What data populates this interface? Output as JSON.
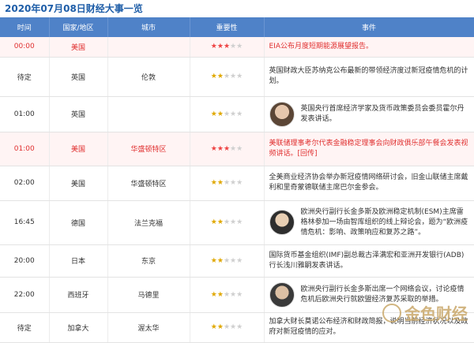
{
  "page_title": "2020年07月08日财经大事一览",
  "headers": [
    "时间",
    "国家/地区",
    "城市",
    "重要性",
    "事件"
  ],
  "colors": {
    "header_bg": "#4f82c8",
    "highlight_red": "#e03030",
    "star_gold": "#e0a800"
  },
  "rows": [
    {
      "time": "00:00",
      "country": "美国",
      "city": "",
      "stars": 3,
      "highlight": true,
      "avatar": "",
      "event": "EIA公布月度短期能源展望报告。",
      "link": ""
    },
    {
      "time": "待定",
      "country": "英国",
      "city": "伦敦",
      "stars": 2,
      "highlight": false,
      "avatar": "",
      "event": "英国财政大臣苏纳克公布最新的带领经济度过新冠疫情危机的计划。",
      "link": ""
    },
    {
      "time": "01:00",
      "country": "英国",
      "city": "",
      "stars": 2,
      "highlight": false,
      "avatar": "a1",
      "event": "英国央行首席经济学家及货币政策委员会委员霍尔丹发表讲话。",
      "link": ""
    },
    {
      "time": "01:00",
      "country": "美国",
      "city": "华盛顿特区",
      "stars": 3,
      "highlight": true,
      "avatar": "",
      "event": "美联储理事考尔代表金融稳定理事会向财政俱乐部午餐会发表视频讲话。",
      "link": "[回传]"
    },
    {
      "time": "02:00",
      "country": "美国",
      "city": "华盛顿特区",
      "stars": 2,
      "highlight": false,
      "avatar": "",
      "event": "全美商业经济协会举办新冠疫情网络研讨会，旧金山联储主席戴利和里奇蒙德联储主席巴尔金参会。",
      "link": ""
    },
    {
      "time": "16:45",
      "country": "德国",
      "city": "法兰克福",
      "stars": 2,
      "highlight": false,
      "avatar": "a2",
      "event": "欧洲央行副行长金多斯及欧洲稳定机制(ESM)主席雷格林参加一场由智库组织的线上辩论会，题为“欧洲疫情危机：影响、政策响应和复苏之路”。",
      "link": ""
    },
    {
      "time": "20:00",
      "country": "日本",
      "city": "东京",
      "stars": 2,
      "highlight": false,
      "avatar": "",
      "event": "国际货币基金组织(IMF)副总裁古泽满宏和亚洲开发银行(ADB)行长浅川雅嗣发表讲话。",
      "link": ""
    },
    {
      "time": "22:00",
      "country": "西班牙",
      "city": "马德里",
      "stars": 2,
      "highlight": false,
      "avatar": "a3",
      "event": "欧洲央行副行长金多斯出席一个网络会议，讨论疫情危机后欧洲央行就欧盟经济复苏采取的举措。",
      "link": ""
    },
    {
      "time": "待定",
      "country": "加拿大",
      "city": "渥太华",
      "stars": 2,
      "highlight": false,
      "avatar": "",
      "event": "加拿大财长莫诺公布经济和财政简报，说明当前经济状况以及政府对新冠疫情的应对。",
      "link": ""
    }
  ],
  "watermark": {
    "text": "金色财经",
    "icon": "jinse-logo-icon"
  }
}
